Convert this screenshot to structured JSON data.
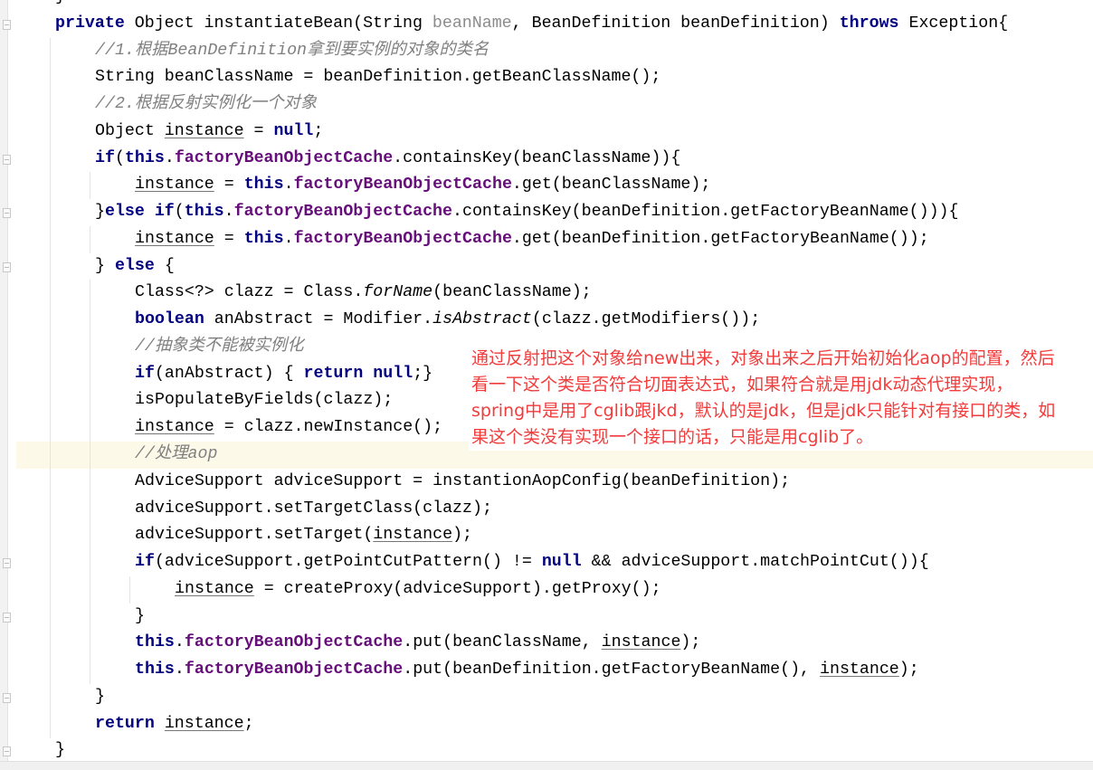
{
  "editor": {
    "language": "java",
    "highlighted_line": 17,
    "lines": [
      {
        "indent": 0,
        "tokens": [
          [
            "p",
            "}"
          ]
        ]
      },
      {
        "indent": 0,
        "tokens": [
          [
            "kw",
            "private"
          ],
          [
            "p",
            " Object instantiateBean(String "
          ],
          [
            "param",
            "beanName"
          ],
          [
            "p",
            ", BeanDefinition beanDefinition) "
          ],
          [
            "kw",
            "throws"
          ],
          [
            "p",
            " Exception{"
          ]
        ]
      },
      {
        "indent": 1,
        "tokens": [
          [
            "cm",
            "//1.根据BeanDefinition拿到要实例的对象的类名"
          ]
        ]
      },
      {
        "indent": 1,
        "tokens": [
          [
            "p",
            "String beanClassName = beanDefinition.getBeanClassName();"
          ]
        ]
      },
      {
        "indent": 1,
        "tokens": [
          [
            "cm",
            "//2.根据反射实例化一个对象"
          ]
        ]
      },
      {
        "indent": 1,
        "tokens": [
          [
            "p",
            "Object "
          ],
          [
            "u",
            "instance"
          ],
          [
            "p",
            " = "
          ],
          [
            "kw",
            "null"
          ],
          [
            "p",
            ";"
          ]
        ]
      },
      {
        "indent": 1,
        "tokens": [
          [
            "kw",
            "if"
          ],
          [
            "p",
            "("
          ],
          [
            "kw",
            "this"
          ],
          [
            "p",
            "."
          ],
          [
            "fld",
            "factoryBeanObjectCache"
          ],
          [
            "p",
            ".containsKey(beanClassName)){"
          ]
        ]
      },
      {
        "indent": 2,
        "tokens": [
          [
            "u",
            "instance"
          ],
          [
            "p",
            " = "
          ],
          [
            "kw",
            "this"
          ],
          [
            "p",
            "."
          ],
          [
            "fld",
            "factoryBeanObjectCache"
          ],
          [
            "p",
            ".get(beanClassName);"
          ]
        ]
      },
      {
        "indent": 1,
        "tokens": [
          [
            "p",
            "}"
          ],
          [
            "kw",
            "else if"
          ],
          [
            "p",
            "("
          ],
          [
            "kw",
            "this"
          ],
          [
            "p",
            "."
          ],
          [
            "fld",
            "factoryBeanObjectCache"
          ],
          [
            "p",
            ".containsKey(beanDefinition.getFactoryBeanName())){"
          ]
        ]
      },
      {
        "indent": 2,
        "tokens": [
          [
            "u",
            "instance"
          ],
          [
            "p",
            " = "
          ],
          [
            "kw",
            "this"
          ],
          [
            "p",
            "."
          ],
          [
            "fld",
            "factoryBeanObjectCache"
          ],
          [
            "p",
            ".get(beanDefinition.getFactoryBeanName());"
          ]
        ]
      },
      {
        "indent": 1,
        "tokens": [
          [
            "p",
            "} "
          ],
          [
            "kw",
            "else"
          ],
          [
            "p",
            " {"
          ]
        ]
      },
      {
        "indent": 2,
        "tokens": [
          [
            "p",
            "Class<?> clazz = Class."
          ],
          [
            "it",
            "forName"
          ],
          [
            "p",
            "(beanClassName);"
          ]
        ]
      },
      {
        "indent": 2,
        "tokens": [
          [
            "kw",
            "boolean"
          ],
          [
            "p",
            " anAbstract = Modifier."
          ],
          [
            "it",
            "isAbstract"
          ],
          [
            "p",
            "(clazz.getModifiers());"
          ]
        ]
      },
      {
        "indent": 2,
        "tokens": [
          [
            "cm",
            "//抽象类不能被实例化"
          ]
        ]
      },
      {
        "indent": 2,
        "tokens": [
          [
            "kw",
            "if"
          ],
          [
            "p",
            "(anAbstract) { "
          ],
          [
            "kw",
            "return null"
          ],
          [
            "p",
            ";}"
          ]
        ]
      },
      {
        "indent": 2,
        "tokens": [
          [
            "p",
            "isPopulateByFields(clazz);"
          ]
        ]
      },
      {
        "indent": 2,
        "tokens": [
          [
            "u",
            "instance"
          ],
          [
            "p",
            " = clazz.newInstance();"
          ]
        ]
      },
      {
        "indent": 2,
        "tokens": [
          [
            "cm",
            "//处理aop"
          ]
        ]
      },
      {
        "indent": 2,
        "tokens": [
          [
            "p",
            "AdviceSupport adviceSupport = instantionAopConfig(beanDefinition);"
          ]
        ]
      },
      {
        "indent": 2,
        "tokens": [
          [
            "p",
            "adviceSupport.setTargetClass(clazz);"
          ]
        ]
      },
      {
        "indent": 2,
        "tokens": [
          [
            "p",
            "adviceSupport.setTarget("
          ],
          [
            "u",
            "instance"
          ],
          [
            "p",
            ");"
          ]
        ]
      },
      {
        "indent": 2,
        "tokens": [
          [
            "kw",
            "if"
          ],
          [
            "p",
            "(adviceSupport.getPointCutPattern() != "
          ],
          [
            "kw",
            "null"
          ],
          [
            "p",
            " && adviceSupport.matchPointCut()){"
          ]
        ]
      },
      {
        "indent": 3,
        "tokens": [
          [
            "u",
            "instance"
          ],
          [
            "p",
            " = createProxy(adviceSupport).getProxy();"
          ]
        ]
      },
      {
        "indent": 2,
        "tokens": [
          [
            "p",
            "}"
          ]
        ]
      },
      {
        "indent": 2,
        "tokens": [
          [
            "kw",
            "this"
          ],
          [
            "p",
            "."
          ],
          [
            "fld",
            "factoryBeanObjectCache"
          ],
          [
            "p",
            ".put(beanClassName, "
          ],
          [
            "u",
            "instance"
          ],
          [
            "p",
            ");"
          ]
        ]
      },
      {
        "indent": 2,
        "tokens": [
          [
            "kw",
            "this"
          ],
          [
            "p",
            "."
          ],
          [
            "fld",
            "factoryBeanObjectCache"
          ],
          [
            "p",
            ".put(beanDefinition.getFactoryBeanName(), "
          ],
          [
            "u",
            "instance"
          ],
          [
            "p",
            ");"
          ]
        ]
      },
      {
        "indent": 1,
        "tokens": [
          [
            "p",
            "}"
          ]
        ]
      },
      {
        "indent": 1,
        "tokens": [
          [
            "kw",
            "return"
          ],
          [
            "p",
            " "
          ],
          [
            "u",
            "instance"
          ],
          [
            "p",
            ";"
          ]
        ]
      },
      {
        "indent": 0,
        "tokens": [
          [
            "p",
            "}"
          ]
        ]
      }
    ]
  },
  "annotation": {
    "color": "#f23b3b",
    "lines": [
      "通过反射把这个对象给new出来，对象出来之后开始初始化aop的配置，然后",
      "看一下这个类是否符合切面表达式，如果符合就是用jdk动态代理实现，",
      "spring中是用了cglib跟jkd，默认的是jdk，但是jdk只能针对有接口的类，如",
      "果这个类没有实现一个接口的话，只能是用cglib了。"
    ]
  }
}
